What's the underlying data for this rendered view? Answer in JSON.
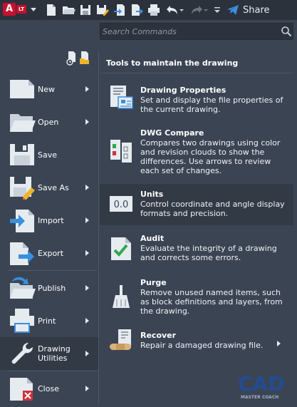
{
  "app": {
    "logo_letter": "A",
    "logo_badge": "LT",
    "accent_color": "#c8102e"
  },
  "toolbar": {
    "icons": [
      "new-icon",
      "open-icon",
      "save-icon",
      "save-as-icon",
      "import-icon",
      "export-icon",
      "plot-icon",
      "undo-icon",
      "redo-icon",
      "share-icon"
    ],
    "share_label": "Share"
  },
  "search": {
    "placeholder": "Search Commands",
    "value": ""
  },
  "menu": {
    "items": [
      {
        "id": "new",
        "label": "New",
        "has_submenu": true,
        "icon": "new-icon"
      },
      {
        "id": "open",
        "label": "Open",
        "has_submenu": true,
        "icon": "open-icon"
      },
      {
        "id": "save",
        "label": "Save",
        "has_submenu": false,
        "icon": "save-icon"
      },
      {
        "id": "save-as",
        "label": "Save As",
        "has_submenu": true,
        "icon": "save-as-icon"
      },
      {
        "id": "import",
        "label": "Import",
        "has_submenu": true,
        "icon": "import-icon"
      },
      {
        "id": "export",
        "label": "Export",
        "has_submenu": true,
        "icon": "export-icon"
      },
      {
        "id": "publish",
        "label": "Publish",
        "has_submenu": true,
        "icon": "publish-icon"
      },
      {
        "id": "print",
        "label": "Print",
        "has_submenu": true,
        "icon": "print-icon"
      },
      {
        "id": "drawing-utilities",
        "label": "Drawing Utilities",
        "has_submenu": true,
        "icon": "wrench-icon",
        "active": true
      },
      {
        "id": "close",
        "label": "Close",
        "has_submenu": true,
        "icon": "close-icon"
      }
    ]
  },
  "panel": {
    "title": "Tools to maintain the drawing",
    "tools": [
      {
        "id": "drawing-properties",
        "name": "Drawing Properties",
        "description": "Set and display the file properties of the current drawing.",
        "icon": "drawing-properties-icon"
      },
      {
        "id": "dwg-compare",
        "name": "DWG Compare",
        "description": "Compares two drawings using color and revision clouds to show the differences. Use arrows to review each set of changes.",
        "icon": "dwg-compare-icon"
      },
      {
        "id": "units",
        "name": "Units",
        "description": "Control coordinate and angle display formats and precision.",
        "icon": "units-icon",
        "icon_text": "0.0",
        "selected": true
      },
      {
        "id": "audit",
        "name": "Audit",
        "description": "Evaluate the integrity of a drawing and corrects some errors.",
        "icon": "audit-icon"
      },
      {
        "id": "purge",
        "name": "Purge",
        "description": "Remove unused named items, such as block definitions and layers, from the drawing.",
        "icon": "purge-icon"
      },
      {
        "id": "recover",
        "name": "Recover",
        "description": "Repair a damaged drawing file.",
        "icon": "recover-icon",
        "has_submenu": true
      }
    ]
  },
  "watermark": {
    "text": "CAD",
    "subtext": "MASTER COACH"
  }
}
